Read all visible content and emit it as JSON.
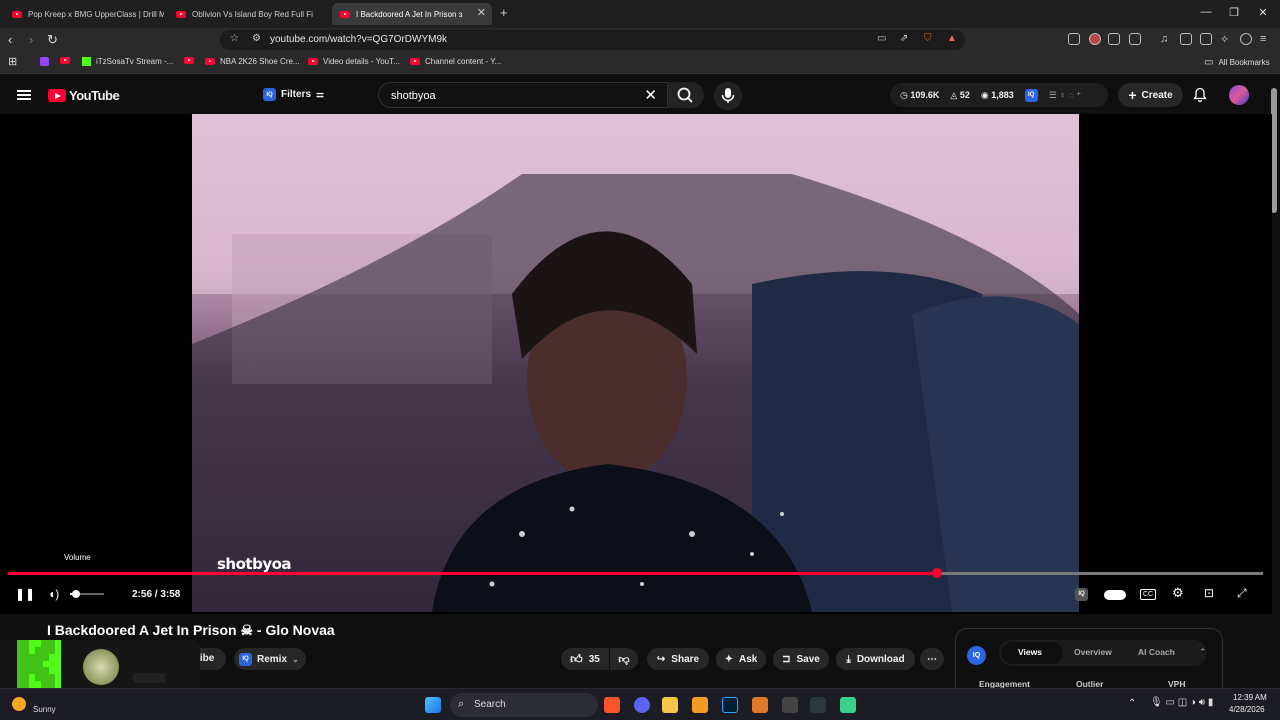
{
  "tabs": [
    {
      "title": "Pop Kreep x BMG UpperClass | Drill M"
    },
    {
      "title": "Oblivion Vs Island Boy Red Full Fi"
    },
    {
      "title": "I Backdoored A Jet In Prison ɜ"
    }
  ],
  "browser": {
    "url": "youtube.com/watch?v=QG7OrDWYM9k",
    "bookmarks": [
      "iTzSosaTv Stream -...",
      "NBA 2K26 Shoe Cre...",
      "Video details - YouT...",
      "Channel content - Y..."
    ],
    "all_bookmarks": "All Bookmarks"
  },
  "yt": {
    "logo": "YouTube",
    "filters": "Filters",
    "search_value": "shotbyoa",
    "stats": {
      "views": "109.6K",
      "likes": "52",
      "watch": "1,883"
    },
    "create": "Create"
  },
  "player": {
    "tooltip": "Volume",
    "time": "2:56 / 3:58",
    "progress_fraction": 0.74,
    "volume_fraction": 0.2,
    "watermark": "shotbyoa"
  },
  "video": {
    "title": "I Backdoored A Jet In Prison ☠ - Glo Novaa",
    "subscribe": "ribe",
    "remix": "Remix",
    "likes": "35",
    "share": "Share",
    "ask": "Ask",
    "save": "Save",
    "download": "Download"
  },
  "iq_panel": {
    "tabs": [
      "Views",
      "Overview",
      "AI Coach"
    ],
    "headers": [
      "Engagement",
      "Outlier",
      "VPH"
    ]
  },
  "taskbar": {
    "search": "Search",
    "weather": "Sunny",
    "time": "12:39 AM",
    "date": "4/28/2026"
  },
  "colors": {
    "accent": "#ff0033",
    "iq": "#2b65e0",
    "kick": "#53fc18"
  }
}
